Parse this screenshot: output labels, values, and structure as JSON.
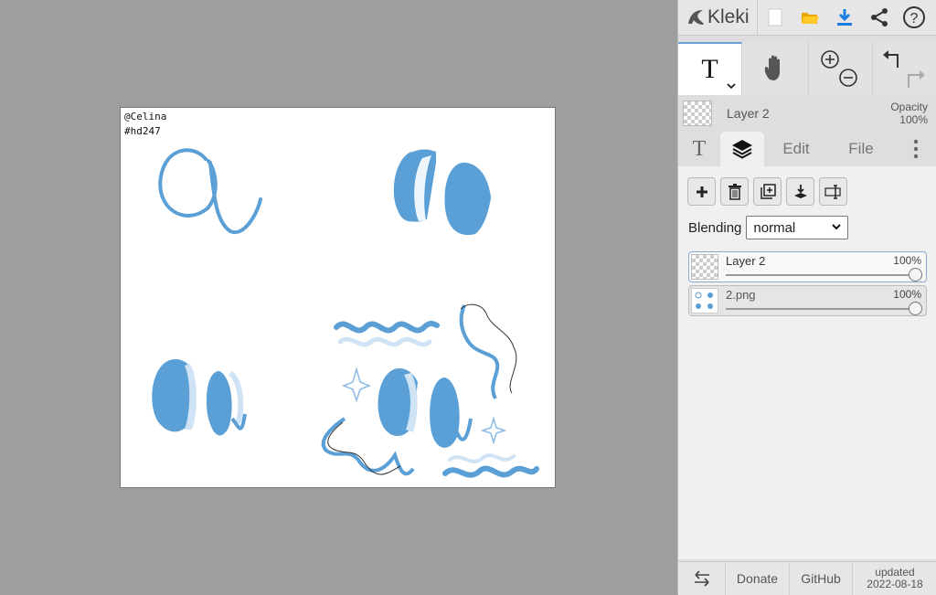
{
  "app": {
    "name": "Kleki"
  },
  "canvas": {
    "text_line1": "@Celina",
    "text_line2": "#hd247",
    "stroke_color": "#5a9fd6",
    "light_color": "#cfe3f5"
  },
  "topbar": {
    "icons": [
      "new-image-icon",
      "open-folder-icon",
      "download-icon",
      "share-icon",
      "help-icon"
    ],
    "help_label": "?"
  },
  "toolbar": {
    "text_tool_label": "T",
    "tools": [
      "text-tool",
      "hand-tool",
      "zoom-tool",
      "undo-redo"
    ]
  },
  "current_layer": {
    "name": "Layer 2",
    "opacity_label": "Opacity",
    "opacity_value": "100%"
  },
  "tabs": {
    "text_tab": "T",
    "edit": "Edit",
    "file": "File",
    "active": "layers"
  },
  "layers_panel": {
    "blending_label": "Blending",
    "blending_value": "normal",
    "layers": [
      {
        "name": "Layer 2",
        "opacity": "100%",
        "selected": true
      },
      {
        "name": "2.png",
        "opacity": "100%",
        "selected": false
      }
    ]
  },
  "footer": {
    "donate": "Donate",
    "github": "GitHub",
    "updated_label": "updated",
    "updated_date": "2022-08-18"
  },
  "colors": {
    "accent": "#5a9fd6",
    "panel_bg": "#dedede",
    "stage_bg": "#9e9e9e"
  }
}
